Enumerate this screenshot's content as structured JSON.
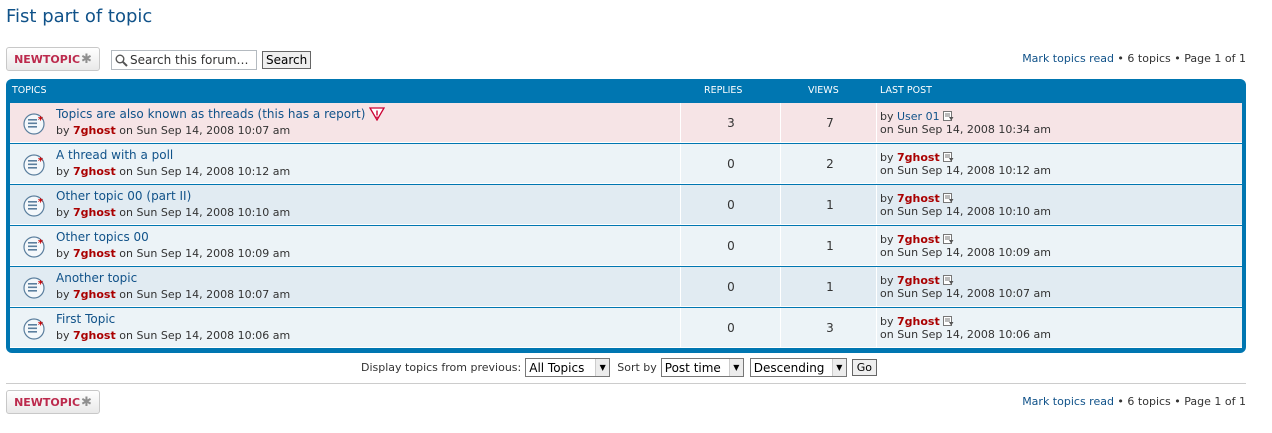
{
  "page_title": "Fist part of topic",
  "new_topic_label": "NEWTOPIC",
  "search": {
    "placeholder": "Search this forum…",
    "button_label": "Search"
  },
  "pagination": {
    "mark_read": "Mark topics read",
    "separator": " • ",
    "topics_count": "6 topics",
    "page_info": "Page 1 of 1"
  },
  "table": {
    "headers": {
      "topics": "TOPICS",
      "replies": "REPLIES",
      "views": "VIEWS",
      "last_post": "LAST POST"
    },
    "rows": [
      {
        "title": "Topics are also known as threads (this has a report)",
        "reported": true,
        "by": "by",
        "author": "7ghost",
        "date_prefix": "on",
        "date": "Sun Sep 14, 2008 10:07 am",
        "replies": "3",
        "views": "7",
        "last_post_by": "by",
        "last_post_user": "User 01",
        "last_post_user_colored": false,
        "last_post_date": "on Sun Sep 14, 2008 10:34 am"
      },
      {
        "title": "A thread with a poll",
        "reported": false,
        "by": "by",
        "author": "7ghost",
        "date_prefix": "on",
        "date": "Sun Sep 14, 2008 10:12 am",
        "replies": "0",
        "views": "2",
        "last_post_by": "by",
        "last_post_user": "7ghost",
        "last_post_user_colored": true,
        "last_post_date": "on Sun Sep 14, 2008 10:12 am"
      },
      {
        "title": "Other topic 00 (part II)",
        "reported": false,
        "by": "by",
        "author": "7ghost",
        "date_prefix": "on",
        "date": "Sun Sep 14, 2008 10:10 am",
        "replies": "0",
        "views": "1",
        "last_post_by": "by",
        "last_post_user": "7ghost",
        "last_post_user_colored": true,
        "last_post_date": "on Sun Sep 14, 2008 10:10 am"
      },
      {
        "title": "Other topics 00",
        "reported": false,
        "by": "by",
        "author": "7ghost",
        "date_prefix": "on",
        "date": "Sun Sep 14, 2008 10:09 am",
        "replies": "0",
        "views": "1",
        "last_post_by": "by",
        "last_post_user": "7ghost",
        "last_post_user_colored": true,
        "last_post_date": "on Sun Sep 14, 2008 10:09 am"
      },
      {
        "title": "Another topic",
        "reported": false,
        "by": "by",
        "author": "7ghost",
        "date_prefix": "on",
        "date": "Sun Sep 14, 2008 10:07 am",
        "replies": "0",
        "views": "1",
        "last_post_by": "by",
        "last_post_user": "7ghost",
        "last_post_user_colored": true,
        "last_post_date": "on Sun Sep 14, 2008 10:07 am"
      },
      {
        "title": "First Topic",
        "reported": false,
        "by": "by",
        "author": "7ghost",
        "date_prefix": "on",
        "date": "Sun Sep 14, 2008 10:06 am",
        "replies": "0",
        "views": "3",
        "last_post_by": "by",
        "last_post_user": "7ghost",
        "last_post_user_colored": true,
        "last_post_date": "on Sun Sep 14, 2008 10:06 am"
      }
    ]
  },
  "sort_bar": {
    "display_label": "Display topics from previous:",
    "display_value": "All Topics",
    "sort_label": "Sort by",
    "sort_value": "Post time",
    "order_value": "Descending",
    "go_label": "Go"
  },
  "icons": {
    "topic_unread": "topic-unread-icon",
    "report": "report-icon",
    "view_latest_post": "view-latest-post-icon",
    "search": "magnifier-icon"
  },
  "colors": {
    "brand_blue": "#0076b1",
    "link": "#105289",
    "author": "#aa0000",
    "reported_row": "#f6e4e6",
    "row_bg1": "#ecf3f7",
    "row_bg2": "#e1ebf2"
  }
}
